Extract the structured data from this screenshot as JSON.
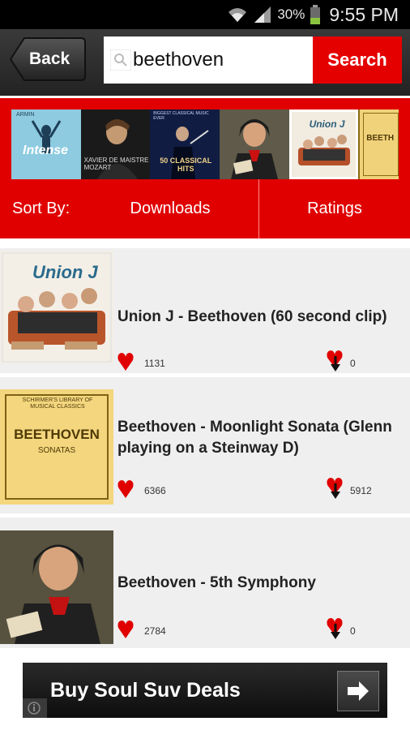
{
  "status_bar": {
    "battery": "30%",
    "time": "9:55 PM"
  },
  "toolbar": {
    "back_label": "Back",
    "search_value": "beethoven",
    "search_label": "Search"
  },
  "carousel": {
    "covers": [
      {
        "name": "intense-cover",
        "text": "Intense",
        "sub": "ARMIN"
      },
      {
        "name": "xavier-mozart-cover",
        "text": "XAVIER DE MAISTRE MOZART"
      },
      {
        "name": "classical-hits-cover",
        "text": "50 CLASSICAL HITS",
        "top": "BIGGEST CLASSICAL MUSIC EVER"
      },
      {
        "name": "beethoven-portrait-cover"
      },
      {
        "name": "union-j-cover",
        "text": "Union J"
      },
      {
        "name": "beethoven-sonatas-cover",
        "text": "BEETH"
      }
    ]
  },
  "sort": {
    "label": "Sort By:",
    "downloads": "Downloads",
    "ratings": "Ratings"
  },
  "results": [
    {
      "title": "Union J - Beethoven (60 second clip)",
      "likes": "1131",
      "dislikes": "0",
      "thumb": "Union J"
    },
    {
      "title": "Beethoven - Moonlight Sonata (Glenn playing on a Steinway D)",
      "likes": "6366",
      "dislikes": "5912",
      "thumb_top": "SCHIRMER'S LIBRARY OF MUSICAL CLASSICS",
      "thumb_title": "BEETHOVEN",
      "thumb_sub": "SONATAS"
    },
    {
      "title": "Beethoven - 5th Symphony",
      "likes": "2784",
      "dislikes": "0"
    }
  ],
  "ad": {
    "text": "Buy Soul Suv Deals"
  },
  "colors": {
    "brand_red": "#e00000",
    "toolbar_dark": "#2b2b2b"
  },
  "icons": [
    "wifi-icon",
    "signal-icon",
    "battery-icon",
    "search-icon",
    "heart-icon",
    "dislike-icon",
    "arrow-right-icon",
    "info-icon"
  ]
}
